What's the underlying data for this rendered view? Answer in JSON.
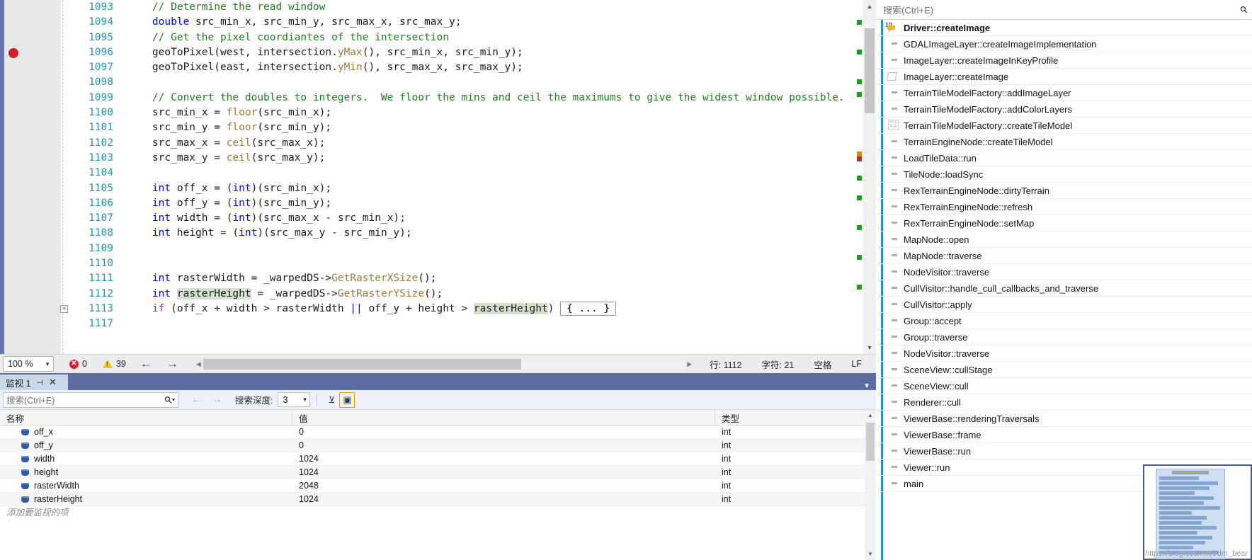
{
  "editor": {
    "lines": [
      {
        "num": "1093",
        "breakpoint": false,
        "fold": false,
        "segments": [
          {
            "t": "    // Determine the read window",
            "c": "cm"
          }
        ]
      },
      {
        "num": "1094",
        "breakpoint": false,
        "fold": false,
        "segments": [
          {
            "t": "    ",
            "c": "op"
          },
          {
            "t": "double",
            "c": "kw"
          },
          {
            "t": " src_min_x, src_min_y, src_max_x, src_max_y;",
            "c": "id"
          }
        ]
      },
      {
        "num": "1095",
        "breakpoint": false,
        "fold": false,
        "segments": [
          {
            "t": "    // Get the pixel coordiantes of the intersection",
            "c": "cm"
          }
        ]
      },
      {
        "num": "1096",
        "breakpoint": true,
        "fold": false,
        "segments": [
          {
            "t": "    ",
            "c": "op"
          },
          {
            "t": "geoToPixel",
            "c": "id"
          },
          {
            "t": "(west, intersection.",
            "c": "id"
          },
          {
            "t": "yMax",
            "c": "fn"
          },
          {
            "t": "(), src_min_x, src_min_y);",
            "c": "id"
          }
        ]
      },
      {
        "num": "1097",
        "breakpoint": false,
        "fold": false,
        "segments": [
          {
            "t": "    ",
            "c": "op"
          },
          {
            "t": "geoToPixel",
            "c": "id"
          },
          {
            "t": "(east, intersection.",
            "c": "id"
          },
          {
            "t": "yMin",
            "c": "fn"
          },
          {
            "t": "(), src_max_x, src_max_y);",
            "c": "id"
          }
        ]
      },
      {
        "num": "1098",
        "breakpoint": false,
        "fold": false,
        "segments": [
          {
            "t": "",
            "c": "id"
          }
        ]
      },
      {
        "num": "1099",
        "breakpoint": false,
        "fold": false,
        "segments": [
          {
            "t": "    // Convert the doubles to integers.  We floor the mins and ceil the maximums to give the widest window possible.",
            "c": "cm"
          }
        ]
      },
      {
        "num": "1100",
        "breakpoint": false,
        "fold": false,
        "segments": [
          {
            "t": "    src_min_x = ",
            "c": "id"
          },
          {
            "t": "floor",
            "c": "fn"
          },
          {
            "t": "(src_min_x);",
            "c": "id"
          }
        ]
      },
      {
        "num": "1101",
        "breakpoint": false,
        "fold": false,
        "segments": [
          {
            "t": "    src_min_y = ",
            "c": "id"
          },
          {
            "t": "floor",
            "c": "fn"
          },
          {
            "t": "(src_min_y);",
            "c": "id"
          }
        ]
      },
      {
        "num": "1102",
        "breakpoint": false,
        "fold": false,
        "segments": [
          {
            "t": "    src_max_x = ",
            "c": "id"
          },
          {
            "t": "ceil",
            "c": "fn"
          },
          {
            "t": "(src_max_x);",
            "c": "id"
          }
        ]
      },
      {
        "num": "1103",
        "breakpoint": false,
        "fold": false,
        "segments": [
          {
            "t": "    src_max_y = ",
            "c": "id"
          },
          {
            "t": "ceil",
            "c": "fn"
          },
          {
            "t": "(src_max_y);",
            "c": "id"
          }
        ]
      },
      {
        "num": "1104",
        "breakpoint": false,
        "fold": false,
        "segments": [
          {
            "t": "",
            "c": "id"
          }
        ]
      },
      {
        "num": "1105",
        "breakpoint": false,
        "fold": false,
        "segments": [
          {
            "t": "    ",
            "c": "op"
          },
          {
            "t": "int",
            "c": "kw"
          },
          {
            "t": " off_x = (",
            "c": "id"
          },
          {
            "t": "int",
            "c": "kw"
          },
          {
            "t": ")(src_min_x);",
            "c": "id"
          }
        ]
      },
      {
        "num": "1106",
        "breakpoint": false,
        "fold": false,
        "segments": [
          {
            "t": "    ",
            "c": "op"
          },
          {
            "t": "int",
            "c": "kw"
          },
          {
            "t": " off_y = (",
            "c": "id"
          },
          {
            "t": "int",
            "c": "kw"
          },
          {
            "t": ")(src_min_y);",
            "c": "id"
          }
        ]
      },
      {
        "num": "1107",
        "breakpoint": false,
        "fold": false,
        "segments": [
          {
            "t": "    ",
            "c": "op"
          },
          {
            "t": "int",
            "c": "kw"
          },
          {
            "t": " width = (",
            "c": "id"
          },
          {
            "t": "int",
            "c": "kw"
          },
          {
            "t": ")(src_max_x - src_min_x);",
            "c": "id"
          }
        ]
      },
      {
        "num": "1108",
        "breakpoint": false,
        "fold": false,
        "segments": [
          {
            "t": "    ",
            "c": "op"
          },
          {
            "t": "int",
            "c": "kw"
          },
          {
            "t": " height = (",
            "c": "id"
          },
          {
            "t": "int",
            "c": "kw"
          },
          {
            "t": ")(src_max_y - src_min_y);",
            "c": "id"
          }
        ]
      },
      {
        "num": "1109",
        "breakpoint": false,
        "fold": false,
        "segments": [
          {
            "t": "",
            "c": "id"
          }
        ]
      },
      {
        "num": "1110",
        "breakpoint": false,
        "fold": false,
        "segments": [
          {
            "t": "",
            "c": "id"
          }
        ]
      },
      {
        "num": "1111",
        "breakpoint": false,
        "fold": false,
        "segments": [
          {
            "t": "    ",
            "c": "op"
          },
          {
            "t": "int",
            "c": "kw"
          },
          {
            "t": " rasterWidth = _warpedDS->",
            "c": "id"
          },
          {
            "t": "GetRasterXSize",
            "c": "fn"
          },
          {
            "t": "();",
            "c": "id"
          }
        ]
      },
      {
        "num": "1112",
        "breakpoint": false,
        "fold": false,
        "segments": [
          {
            "t": "    ",
            "c": "op"
          },
          {
            "t": "int",
            "c": "kw"
          },
          {
            "t": " ",
            "c": "id"
          },
          {
            "t": "rasterHeight",
            "c": "id hl"
          },
          {
            "t": " = _warpedDS->",
            "c": "id"
          },
          {
            "t": "GetRasterYSize",
            "c": "fn"
          },
          {
            "t": "();",
            "c": "id"
          }
        ]
      },
      {
        "num": "1113",
        "breakpoint": false,
        "fold": true,
        "segments": [
          {
            "t": "    ",
            "c": "op"
          },
          {
            "t": "if",
            "c": "pp"
          },
          {
            "t": " (off_x + width > rasterWidth ",
            "c": "id"
          },
          {
            "t": "||",
            "c": "kw"
          },
          {
            "t": " off_y + height > ",
            "c": "id"
          },
          {
            "t": "rasterHeight",
            "c": "id hl"
          },
          {
            "t": ")",
            "c": "id"
          }
        ],
        "collapsed": "{ ... }"
      },
      {
        "num": "1117",
        "breakpoint": false,
        "fold": false,
        "segments": [
          {
            "t": "",
            "c": "id"
          }
        ]
      }
    ],
    "status": {
      "zoom": "100 %",
      "error_count": "0",
      "warning_count": "39",
      "line_label": "行: 1112",
      "char_label": "字符: 21",
      "space_label": "空格",
      "eol_label": "LF"
    }
  },
  "watch": {
    "tab_label": "监视 1",
    "search_placeholder": "搜索(Ctrl+E)",
    "depth_label": "搜索深度:",
    "depth_value": "3",
    "columns": [
      "名称",
      "值",
      "类型"
    ],
    "rows": [
      {
        "name": "off_x",
        "value": "0",
        "type": "int"
      },
      {
        "name": "off_y",
        "value": "0",
        "type": "int"
      },
      {
        "name": "width",
        "value": "1024",
        "type": "int"
      },
      {
        "name": "height",
        "value": "1024",
        "type": "int"
      },
      {
        "name": "rasterWidth",
        "value": "2048",
        "type": "int"
      },
      {
        "name": "rasterHeight",
        "value": "1024",
        "type": "int"
      }
    ],
    "add_watch_hint": "添加要监视的项"
  },
  "callstack": {
    "search_placeholder": "搜索(Ctrl+E)",
    "frames": [
      {
        "label": "Driver::createImage",
        "current": true,
        "icon": "current-frame-arrow-icon",
        "index": "10"
      },
      {
        "label": "GDALImageLayer::createImageImplementation",
        "current": false,
        "icon": "dash-icon"
      },
      {
        "label": "ImageLayer::createImageInKeyProfile",
        "current": false,
        "icon": "dash-icon"
      },
      {
        "label": "ImageLayer::createImage",
        "current": false,
        "icon": "hollow-frame-icon"
      },
      {
        "label": "TerrainTileModelFactory::addImageLayer",
        "current": false,
        "icon": "dash-icon"
      },
      {
        "label": "TerrainTileModelFactory::addColorLayers",
        "current": false,
        "icon": "dash-icon"
      },
      {
        "label": "TerrainTileModelFactory::createTileModel",
        "current": false,
        "icon": "frame-box-icon"
      },
      {
        "label": "TerrainEngineNode::createTileModel",
        "current": false,
        "icon": "dash-icon"
      },
      {
        "label": "LoadTileData::run",
        "current": false,
        "icon": "dash-icon"
      },
      {
        "label": "TileNode::loadSync",
        "current": false,
        "icon": "dash-icon"
      },
      {
        "label": "RexTerrainEngineNode::dirtyTerrain",
        "current": false,
        "icon": "dash-icon"
      },
      {
        "label": "RexTerrainEngineNode::refresh",
        "current": false,
        "icon": "dash-icon"
      },
      {
        "label": "RexTerrainEngineNode::setMap",
        "current": false,
        "icon": "dash-icon"
      },
      {
        "label": "MapNode::open",
        "current": false,
        "icon": "dash-icon"
      },
      {
        "label": "MapNode::traverse",
        "current": false,
        "icon": "dash-icon"
      },
      {
        "label": "NodeVisitor::traverse",
        "current": false,
        "icon": "dash-icon"
      },
      {
        "label": "CullVisitor::handle_cull_callbacks_and_traverse",
        "current": false,
        "icon": "dash-icon"
      },
      {
        "label": "CullVisitor::apply",
        "current": false,
        "icon": "dash-icon"
      },
      {
        "label": "Group::accept",
        "current": false,
        "icon": "dash-icon"
      },
      {
        "label": "Group::traverse",
        "current": false,
        "icon": "dash-icon"
      },
      {
        "label": "NodeVisitor::traverse",
        "current": false,
        "icon": "dash-icon"
      },
      {
        "label": "SceneView::cullStage",
        "current": false,
        "icon": "dash-icon"
      },
      {
        "label": "SceneView::cull",
        "current": false,
        "icon": "dash-icon"
      },
      {
        "label": "Renderer::cull",
        "current": false,
        "icon": "dash-icon"
      },
      {
        "label": "ViewerBase::renderingTraversals",
        "current": false,
        "icon": "dash-icon"
      },
      {
        "label": "ViewerBase::frame",
        "current": false,
        "icon": "dash-icon"
      },
      {
        "label": "ViewerBase::run",
        "current": false,
        "icon": "dash-icon"
      },
      {
        "label": "Viewer::run",
        "current": false,
        "icon": "dash-icon"
      },
      {
        "label": "main",
        "current": false,
        "icon": "dash-icon"
      }
    ]
  },
  "watermark": "https://blog.csdn.net/dm_bear"
}
